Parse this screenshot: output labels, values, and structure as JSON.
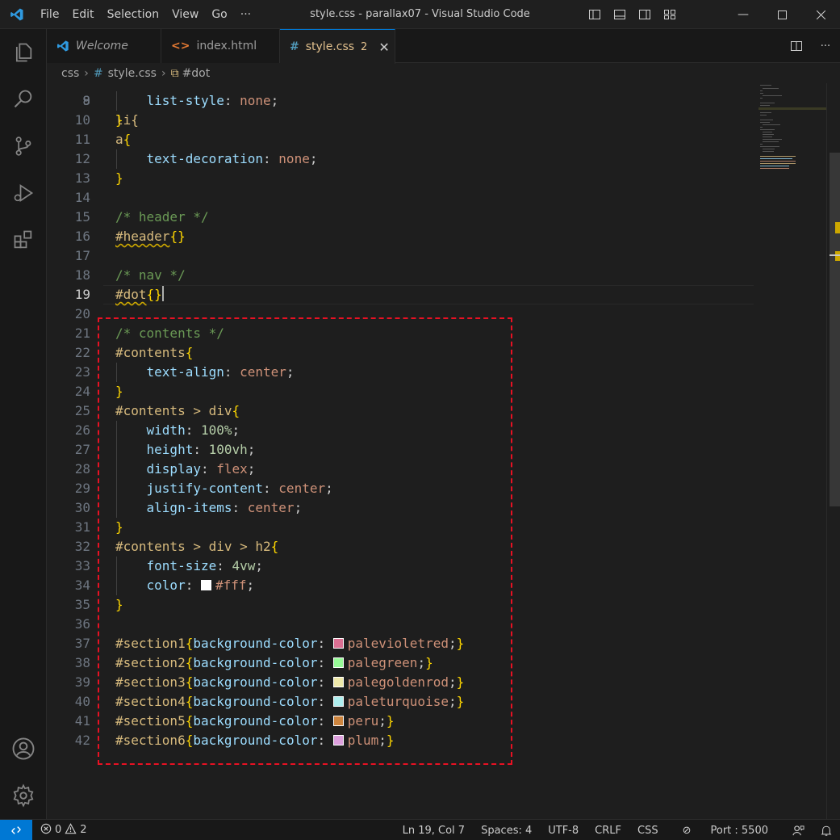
{
  "titlebar": {
    "title": "style.css - parallax07 - Visual Studio Code",
    "menu": [
      "File",
      "Edit",
      "Selection",
      "View",
      "Go",
      "···"
    ]
  },
  "tabs": [
    {
      "label": "Welcome",
      "icon": "vscode-icon"
    },
    {
      "label": "index.html",
      "icon": "html-icon"
    },
    {
      "label": "style.css",
      "icon": "css-hash-icon",
      "badge": "2",
      "active": true
    }
  ],
  "breadcrumb": {
    "folder": "css",
    "file": "style.css",
    "symbol": "#dot"
  },
  "editor": {
    "current_line": 19,
    "first_partial_text": "li{",
    "lines": [
      {
        "n": "9",
        "segs": [
          [
            "punc",
            "    "
          ],
          [
            "prop",
            "list-style"
          ],
          [
            "punc",
            ": "
          ],
          [
            "val",
            "none"
          ],
          [
            "punc",
            ";"
          ]
        ]
      },
      {
        "n": "10",
        "segs": [
          [
            "brace",
            "}"
          ]
        ]
      },
      {
        "n": "11",
        "segs": [
          [
            "sel",
            "a"
          ],
          [
            "brace",
            "{"
          ]
        ]
      },
      {
        "n": "12",
        "segs": [
          [
            "punc",
            "    "
          ],
          [
            "prop",
            "text-decoration"
          ],
          [
            "punc",
            ": "
          ],
          [
            "val",
            "none"
          ],
          [
            "punc",
            ";"
          ]
        ]
      },
      {
        "n": "13",
        "segs": [
          [
            "brace",
            "}"
          ]
        ]
      },
      {
        "n": "14",
        "segs": []
      },
      {
        "n": "15",
        "segs": [
          [
            "com",
            "/* header */"
          ]
        ]
      },
      {
        "n": "16",
        "segs": [
          [
            "sel squig",
            "#header"
          ],
          [
            "brace",
            "{}"
          ]
        ]
      },
      {
        "n": "17",
        "segs": []
      },
      {
        "n": "18",
        "segs": [
          [
            "com",
            "/* nav */"
          ]
        ]
      },
      {
        "n": "19",
        "segs": [
          [
            "sel squig",
            "#dot"
          ],
          [
            "brace",
            "{}"
          ],
          [
            "cursor",
            ""
          ]
        ]
      },
      {
        "n": "20",
        "segs": []
      },
      {
        "n": "21",
        "segs": [
          [
            "com",
            "/* contents */"
          ]
        ]
      },
      {
        "n": "22",
        "segs": [
          [
            "sel",
            "#contents"
          ],
          [
            "brace",
            "{"
          ]
        ]
      },
      {
        "n": "23",
        "segs": [
          [
            "punc",
            "    "
          ],
          [
            "prop",
            "text-align"
          ],
          [
            "punc",
            ": "
          ],
          [
            "val",
            "center"
          ],
          [
            "punc",
            ";"
          ]
        ]
      },
      {
        "n": "24",
        "segs": [
          [
            "brace",
            "}"
          ]
        ]
      },
      {
        "n": "25",
        "segs": [
          [
            "sel",
            "#contents > div"
          ],
          [
            "brace",
            "{"
          ]
        ]
      },
      {
        "n": "26",
        "segs": [
          [
            "punc",
            "    "
          ],
          [
            "prop",
            "width"
          ],
          [
            "punc",
            ": "
          ],
          [
            "num",
            "100%"
          ],
          [
            "punc",
            ";"
          ]
        ]
      },
      {
        "n": "27",
        "segs": [
          [
            "punc",
            "    "
          ],
          [
            "prop",
            "height"
          ],
          [
            "punc",
            ": "
          ],
          [
            "num",
            "100vh"
          ],
          [
            "punc",
            ";"
          ]
        ]
      },
      {
        "n": "28",
        "segs": [
          [
            "punc",
            "    "
          ],
          [
            "prop",
            "display"
          ],
          [
            "punc",
            ": "
          ],
          [
            "val",
            "flex"
          ],
          [
            "punc",
            ";"
          ]
        ]
      },
      {
        "n": "29",
        "segs": [
          [
            "punc",
            "    "
          ],
          [
            "prop",
            "justify-content"
          ],
          [
            "punc",
            ": "
          ],
          [
            "val",
            "center"
          ],
          [
            "punc",
            ";"
          ]
        ]
      },
      {
        "n": "30",
        "segs": [
          [
            "punc",
            "    "
          ],
          [
            "prop",
            "align-items"
          ],
          [
            "punc",
            ": "
          ],
          [
            "val",
            "center"
          ],
          [
            "punc",
            ";"
          ]
        ]
      },
      {
        "n": "31",
        "segs": [
          [
            "brace",
            "}"
          ]
        ]
      },
      {
        "n": "32",
        "segs": [
          [
            "sel",
            "#contents > div > h2"
          ],
          [
            "brace",
            "{"
          ]
        ]
      },
      {
        "n": "33",
        "segs": [
          [
            "punc",
            "    "
          ],
          [
            "prop",
            "font-size"
          ],
          [
            "punc",
            ": "
          ],
          [
            "num",
            "4vw"
          ],
          [
            "punc",
            ";"
          ]
        ]
      },
      {
        "n": "34",
        "segs": [
          [
            "punc",
            "    "
          ],
          [
            "prop",
            "color"
          ],
          [
            "punc",
            ": "
          ],
          [
            "swatch",
            "#ffffff"
          ],
          [
            "val",
            "#fff"
          ],
          [
            "punc",
            ";"
          ]
        ]
      },
      {
        "n": "35",
        "segs": [
          [
            "brace",
            "}"
          ]
        ]
      },
      {
        "n": "36",
        "segs": []
      },
      {
        "n": "37",
        "segs": [
          [
            "sel",
            "#section1"
          ],
          [
            "brace",
            "{"
          ],
          [
            "prop",
            "background-color"
          ],
          [
            "punc",
            ": "
          ],
          [
            "swatch",
            "#db7093"
          ],
          [
            "val",
            "palevioletred"
          ],
          [
            "punc",
            ";"
          ],
          [
            "brace",
            "}"
          ]
        ]
      },
      {
        "n": "38",
        "segs": [
          [
            "sel",
            "#section2"
          ],
          [
            "brace",
            "{"
          ],
          [
            "prop",
            "background-color"
          ],
          [
            "punc",
            ": "
          ],
          [
            "swatch",
            "#98fb98"
          ],
          [
            "val",
            "palegreen"
          ],
          [
            "punc",
            ";"
          ],
          [
            "brace",
            "}"
          ]
        ]
      },
      {
        "n": "39",
        "segs": [
          [
            "sel",
            "#section3"
          ],
          [
            "brace",
            "{"
          ],
          [
            "prop",
            "background-color"
          ],
          [
            "punc",
            ": "
          ],
          [
            "swatch",
            "#eee8aa"
          ],
          [
            "val",
            "palegoldenrod"
          ],
          [
            "punc",
            ";"
          ],
          [
            "brace",
            "}"
          ]
        ]
      },
      {
        "n": "40",
        "segs": [
          [
            "sel",
            "#section4"
          ],
          [
            "brace",
            "{"
          ],
          [
            "prop",
            "background-color"
          ],
          [
            "punc",
            ": "
          ],
          [
            "swatch",
            "#afeeee"
          ],
          [
            "val",
            "paleturquoise"
          ],
          [
            "punc",
            ";"
          ],
          [
            "brace",
            "}"
          ]
        ]
      },
      {
        "n": "41",
        "segs": [
          [
            "sel",
            "#section5"
          ],
          [
            "brace",
            "{"
          ],
          [
            "prop",
            "background-color"
          ],
          [
            "punc",
            ": "
          ],
          [
            "swatch",
            "#cd853f"
          ],
          [
            "val",
            "peru"
          ],
          [
            "punc",
            ";"
          ],
          [
            "brace",
            "}"
          ]
        ]
      },
      {
        "n": "42",
        "segs": [
          [
            "sel",
            "#section6"
          ],
          [
            "brace",
            "{"
          ],
          [
            "prop",
            "background-color"
          ],
          [
            "punc",
            ": "
          ],
          [
            "swatch",
            "#dda0dd"
          ],
          [
            "val",
            "plum"
          ],
          [
            "punc",
            ";"
          ],
          [
            "brace",
            "}"
          ]
        ]
      }
    ]
  },
  "statusbar": {
    "errors": "0",
    "warnings": "2",
    "position": "Ln 19, Col 7",
    "spaces": "Spaces: 4",
    "encoding": "UTF-8",
    "eol": "CRLF",
    "language": "CSS",
    "port": "Port : 5500"
  },
  "colors": {
    "accent": "#0078d4",
    "annotation": "#e81123"
  }
}
